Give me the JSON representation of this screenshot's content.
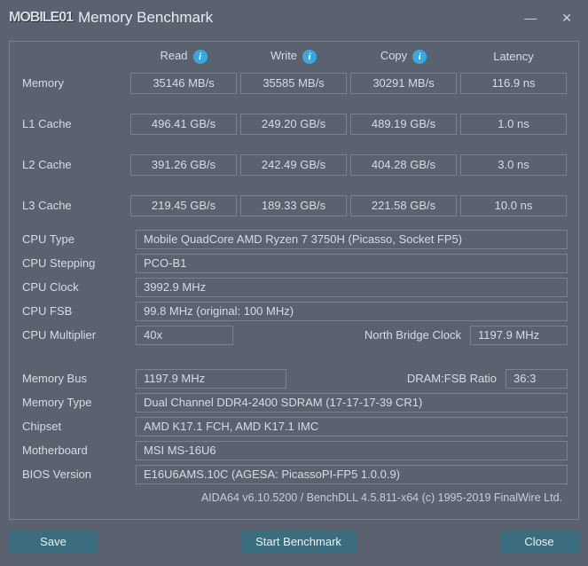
{
  "title": "Memory Benchmark",
  "logo_text": "MOBILE01",
  "columns": {
    "read": "Read",
    "write": "Write",
    "copy": "Copy",
    "latency": "Latency"
  },
  "rows": {
    "memory": {
      "label": "Memory",
      "read": "35146 MB/s",
      "write": "35585 MB/s",
      "copy": "30291 MB/s",
      "latency": "116.9 ns"
    },
    "l1": {
      "label": "L1 Cache",
      "read": "496.41 GB/s",
      "write": "249.20 GB/s",
      "copy": "489.19 GB/s",
      "latency": "1.0 ns"
    },
    "l2": {
      "label": "L2 Cache",
      "read": "391.26 GB/s",
      "write": "242.49 GB/s",
      "copy": "404.28 GB/s",
      "latency": "3.0 ns"
    },
    "l3": {
      "label": "L3 Cache",
      "read": "219.45 GB/s",
      "write": "189.33 GB/s",
      "copy": "221.58 GB/s",
      "latency": "10.0 ns"
    }
  },
  "cpu": {
    "type_label": "CPU Type",
    "type": "Mobile QuadCore AMD Ryzen 7 3750H  (Picasso, Socket FP5)",
    "step_label": "CPU Stepping",
    "step": "PCO-B1",
    "clock_label": "CPU Clock",
    "clock": "3992.9 MHz",
    "fsb_label": "CPU FSB",
    "fsb": "99.8 MHz  (original: 100 MHz)",
    "mult_label": "CPU Multiplier",
    "mult": "40x",
    "nb_label": "North Bridge Clock",
    "nb": "1197.9 MHz"
  },
  "mem": {
    "bus_label": "Memory Bus",
    "bus": "1197.9 MHz",
    "ratio_label": "DRAM:FSB Ratio",
    "ratio": "36:3",
    "type_label": "Memory Type",
    "type": "Dual Channel DDR4-2400 SDRAM  (17-17-17-39 CR1)",
    "chip_label": "Chipset",
    "chip": "AMD K17.1 FCH, AMD K17.1 IMC",
    "mb_label": "Motherboard",
    "mb": "MSI MS-16U6",
    "bios_label": "BIOS Version",
    "bios": "E16U6AMS.10C  (AGESA: PicassoPI-FP5 1.0.0.9)"
  },
  "footer": "AIDA64 v6.10.5200 / BenchDLL 4.5.811-x64   (c) 1995-2019 FinalWire Ltd.",
  "buttons": {
    "save": "Save",
    "start": "Start Benchmark",
    "close": "Close"
  }
}
